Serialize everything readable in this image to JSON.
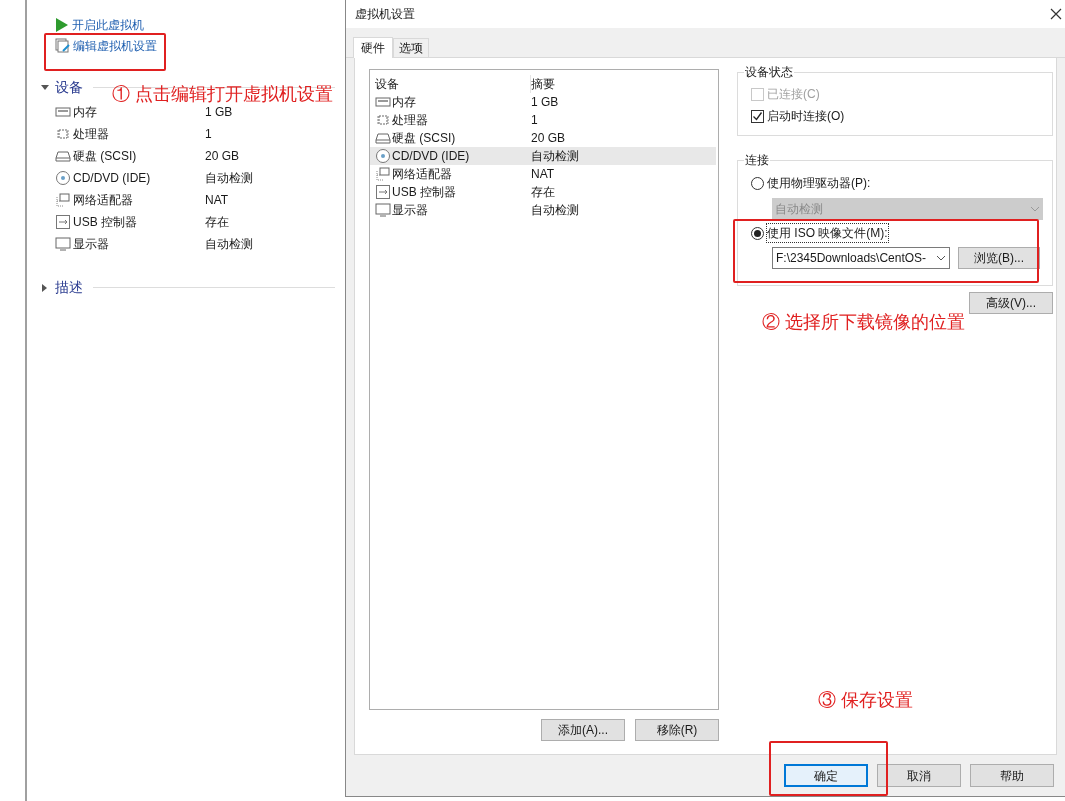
{
  "main_window": {
    "actions": [
      {
        "kind": "power-on",
        "label": "开启此虚拟机"
      },
      {
        "kind": "edit",
        "label": "编辑虚拟机设置"
      }
    ],
    "devices_section": {
      "title": "设备",
      "expanded": true,
      "devices": [
        {
          "kind": "memory",
          "name": "内存",
          "summary": "1 GB"
        },
        {
          "kind": "cpu",
          "name": "处理器",
          "summary": "1"
        },
        {
          "kind": "disk",
          "name": "硬盘 (SCSI)",
          "summary": "20 GB"
        },
        {
          "kind": "cd",
          "name": "CD/DVD (IDE)",
          "summary": "自动检测"
        },
        {
          "kind": "network",
          "name": "网络适配器",
          "summary": "NAT"
        },
        {
          "kind": "usb",
          "name": "USB 控制器",
          "summary": "存在"
        },
        {
          "kind": "display",
          "name": "显示器",
          "summary": "自动检测"
        }
      ]
    },
    "description_section": {
      "title": "描述",
      "expanded": false
    }
  },
  "dialog": {
    "title": "虚拟机设置",
    "tabs": [
      {
        "label": "硬件",
        "selected": true
      },
      {
        "label": "选项",
        "selected": false
      }
    ],
    "device_list": {
      "columns": [
        "设备",
        "摘要"
      ],
      "rows": [
        {
          "kind": "memory",
          "name": "内存",
          "summary": "1 GB",
          "selected": false
        },
        {
          "kind": "cpu",
          "name": "处理器",
          "summary": "1",
          "selected": false
        },
        {
          "kind": "disk",
          "name": "硬盘 (SCSI)",
          "summary": "20 GB",
          "selected": false
        },
        {
          "kind": "cd",
          "name": "CD/DVD (IDE)",
          "summary": "自动检测",
          "selected": true
        },
        {
          "kind": "network",
          "name": "网络适配器",
          "summary": "NAT",
          "selected": false
        },
        {
          "kind": "usb",
          "name": "USB 控制器",
          "summary": "存在",
          "selected": false
        },
        {
          "kind": "display",
          "name": "显示器",
          "summary": "自动检测",
          "selected": false
        }
      ]
    },
    "list_buttons": [
      "添加(A)...",
      "移除(R)"
    ],
    "device_status": {
      "title": "设备状态",
      "options": [
        {
          "label": "已连接(C)",
          "checked": false,
          "disabled": true
        },
        {
          "label": "启动时连接(O)",
          "checked": true,
          "disabled": false
        }
      ]
    },
    "connection": {
      "title": "连接",
      "options": [
        {
          "kind": "physical",
          "label": "使用物理驱动器(P):",
          "selected": false,
          "dropdown": {
            "value": "自动检测",
            "disabled": true
          }
        },
        {
          "kind": "iso",
          "label": "使用 ISO 映像文件(M):",
          "selected": true,
          "path": "F:\\2345Downloads\\CentOS-",
          "browse_button": "浏览(B)..."
        }
      ]
    },
    "advanced_button": "高级(V)...",
    "footer_buttons": [
      {
        "label": "确定",
        "default": true
      },
      {
        "label": "取消",
        "default": false
      },
      {
        "label": "帮助",
        "default": false
      }
    ]
  },
  "annotations": [
    {
      "text": "① 点击编辑打开虚拟机设置"
    },
    {
      "text": "② 选择所下载镜像的位置"
    },
    {
      "text": "③ 保存设置"
    }
  ]
}
